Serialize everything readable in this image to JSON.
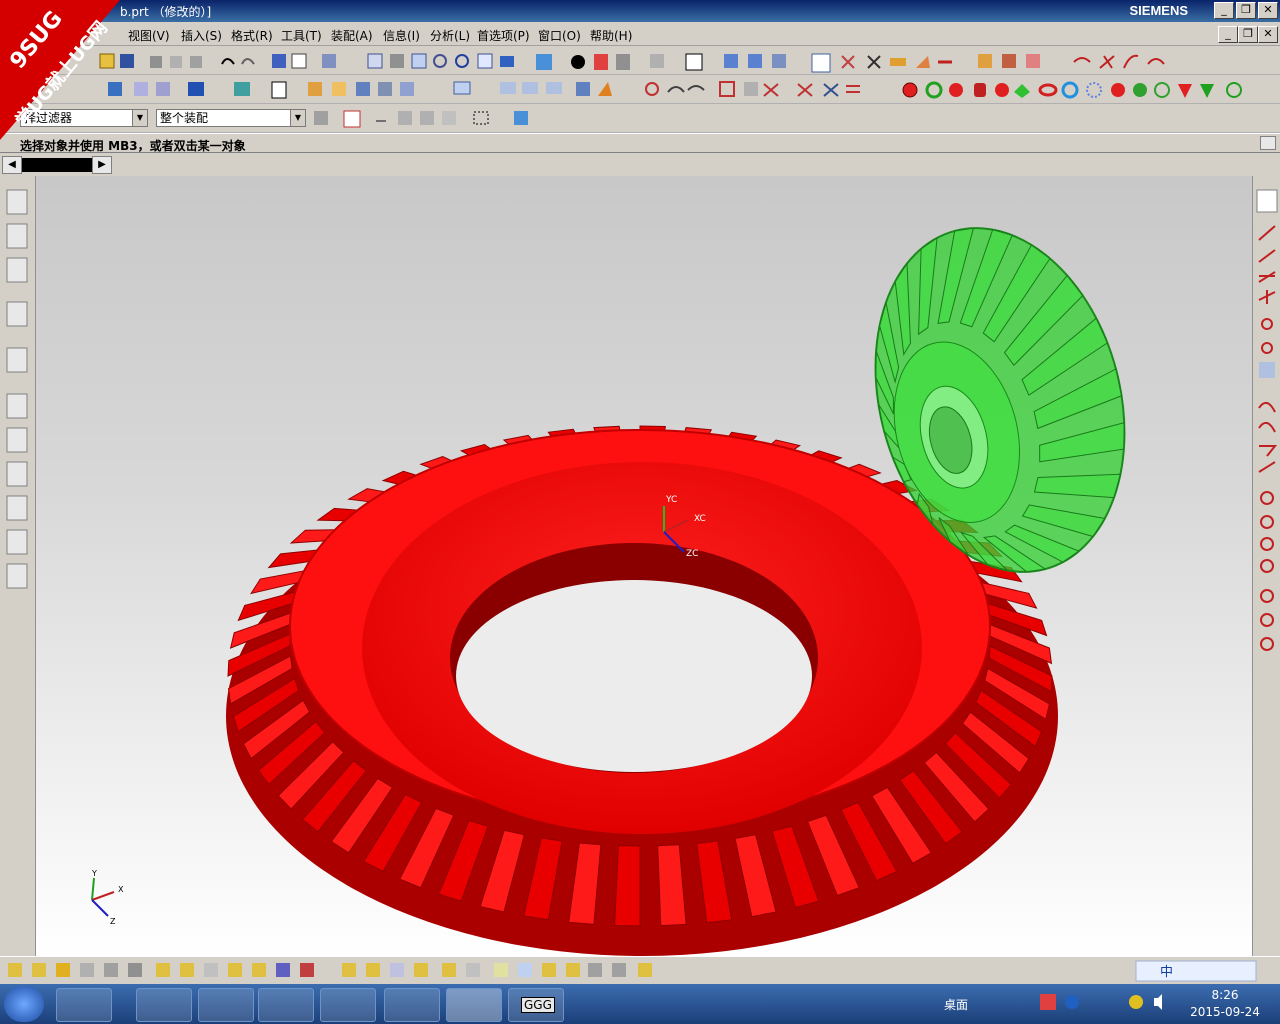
{
  "window": {
    "title": "b.prt （修改的）]",
    "brand": "SIEMENS",
    "min_glyph": "_",
    "restore_glyph": "❐",
    "close_glyph": "✕"
  },
  "watermark": {
    "line1": "9SUG",
    "line2": "学UG就上UG网",
    "color": "#d40000"
  },
  "menu": {
    "items": [
      "视图(V)",
      "插入(S)",
      "格式(R)",
      "工具(T)",
      "装配(A)",
      "信息(I)",
      "分析(L)",
      "首选项(P)",
      "窗口(O)",
      "帮助(H)"
    ]
  },
  "filter": {
    "type_value": "择过滤器",
    "scope_value": "整个装配"
  },
  "prompt": {
    "text": "选择对象并使用 MB3，或者双击某一对象"
  },
  "viewport": {
    "wcs_labels": {
      "x": "XC",
      "y": "YC",
      "z": "ZC"
    },
    "triad_labels": {
      "x": "X",
      "y": "Y",
      "z": "Z"
    },
    "colors": {
      "ring_gear": "#ff0000",
      "pinion": "#33dd33"
    }
  },
  "taskbar": {
    "desktop_label": "桌面",
    "time": "8:26",
    "date": "2015-09-24",
    "ime": "中",
    "task_ggg": "GGG"
  }
}
